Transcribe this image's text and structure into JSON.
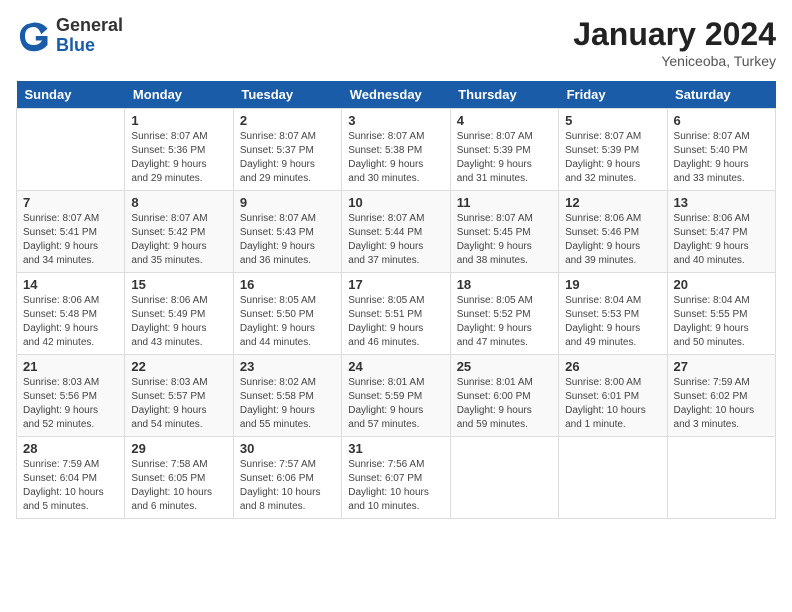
{
  "header": {
    "logo": {
      "general": "General",
      "blue": "Blue"
    },
    "title": "January 2024",
    "subtitle": "Yeniceoba, Turkey"
  },
  "days_of_week": [
    "Sunday",
    "Monday",
    "Tuesday",
    "Wednesday",
    "Thursday",
    "Friday",
    "Saturday"
  ],
  "weeks": [
    [
      {
        "day": "",
        "info": ""
      },
      {
        "day": "1",
        "info": "Sunrise: 8:07 AM\nSunset: 5:36 PM\nDaylight: 9 hours\nand 29 minutes."
      },
      {
        "day": "2",
        "info": "Sunrise: 8:07 AM\nSunset: 5:37 PM\nDaylight: 9 hours\nand 29 minutes."
      },
      {
        "day": "3",
        "info": "Sunrise: 8:07 AM\nSunset: 5:38 PM\nDaylight: 9 hours\nand 30 minutes."
      },
      {
        "day": "4",
        "info": "Sunrise: 8:07 AM\nSunset: 5:39 PM\nDaylight: 9 hours\nand 31 minutes."
      },
      {
        "day": "5",
        "info": "Sunrise: 8:07 AM\nSunset: 5:39 PM\nDaylight: 9 hours\nand 32 minutes."
      },
      {
        "day": "6",
        "info": "Sunrise: 8:07 AM\nSunset: 5:40 PM\nDaylight: 9 hours\nand 33 minutes."
      }
    ],
    [
      {
        "day": "7",
        "info": "Sunrise: 8:07 AM\nSunset: 5:41 PM\nDaylight: 9 hours\nand 34 minutes."
      },
      {
        "day": "8",
        "info": "Sunrise: 8:07 AM\nSunset: 5:42 PM\nDaylight: 9 hours\nand 35 minutes."
      },
      {
        "day": "9",
        "info": "Sunrise: 8:07 AM\nSunset: 5:43 PM\nDaylight: 9 hours\nand 36 minutes."
      },
      {
        "day": "10",
        "info": "Sunrise: 8:07 AM\nSunset: 5:44 PM\nDaylight: 9 hours\nand 37 minutes."
      },
      {
        "day": "11",
        "info": "Sunrise: 8:07 AM\nSunset: 5:45 PM\nDaylight: 9 hours\nand 38 minutes."
      },
      {
        "day": "12",
        "info": "Sunrise: 8:06 AM\nSunset: 5:46 PM\nDaylight: 9 hours\nand 39 minutes."
      },
      {
        "day": "13",
        "info": "Sunrise: 8:06 AM\nSunset: 5:47 PM\nDaylight: 9 hours\nand 40 minutes."
      }
    ],
    [
      {
        "day": "14",
        "info": "Sunrise: 8:06 AM\nSunset: 5:48 PM\nDaylight: 9 hours\nand 42 minutes."
      },
      {
        "day": "15",
        "info": "Sunrise: 8:06 AM\nSunset: 5:49 PM\nDaylight: 9 hours\nand 43 minutes."
      },
      {
        "day": "16",
        "info": "Sunrise: 8:05 AM\nSunset: 5:50 PM\nDaylight: 9 hours\nand 44 minutes."
      },
      {
        "day": "17",
        "info": "Sunrise: 8:05 AM\nSunset: 5:51 PM\nDaylight: 9 hours\nand 46 minutes."
      },
      {
        "day": "18",
        "info": "Sunrise: 8:05 AM\nSunset: 5:52 PM\nDaylight: 9 hours\nand 47 minutes."
      },
      {
        "day": "19",
        "info": "Sunrise: 8:04 AM\nSunset: 5:53 PM\nDaylight: 9 hours\nand 49 minutes."
      },
      {
        "day": "20",
        "info": "Sunrise: 8:04 AM\nSunset: 5:55 PM\nDaylight: 9 hours\nand 50 minutes."
      }
    ],
    [
      {
        "day": "21",
        "info": "Sunrise: 8:03 AM\nSunset: 5:56 PM\nDaylight: 9 hours\nand 52 minutes."
      },
      {
        "day": "22",
        "info": "Sunrise: 8:03 AM\nSunset: 5:57 PM\nDaylight: 9 hours\nand 54 minutes."
      },
      {
        "day": "23",
        "info": "Sunrise: 8:02 AM\nSunset: 5:58 PM\nDaylight: 9 hours\nand 55 minutes."
      },
      {
        "day": "24",
        "info": "Sunrise: 8:01 AM\nSunset: 5:59 PM\nDaylight: 9 hours\nand 57 minutes."
      },
      {
        "day": "25",
        "info": "Sunrise: 8:01 AM\nSunset: 6:00 PM\nDaylight: 9 hours\nand 59 minutes."
      },
      {
        "day": "26",
        "info": "Sunrise: 8:00 AM\nSunset: 6:01 PM\nDaylight: 10 hours\nand 1 minute."
      },
      {
        "day": "27",
        "info": "Sunrise: 7:59 AM\nSunset: 6:02 PM\nDaylight: 10 hours\nand 3 minutes."
      }
    ],
    [
      {
        "day": "28",
        "info": "Sunrise: 7:59 AM\nSunset: 6:04 PM\nDaylight: 10 hours\nand 5 minutes."
      },
      {
        "day": "29",
        "info": "Sunrise: 7:58 AM\nSunset: 6:05 PM\nDaylight: 10 hours\nand 6 minutes."
      },
      {
        "day": "30",
        "info": "Sunrise: 7:57 AM\nSunset: 6:06 PM\nDaylight: 10 hours\nand 8 minutes."
      },
      {
        "day": "31",
        "info": "Sunrise: 7:56 AM\nSunset: 6:07 PM\nDaylight: 10 hours\nand 10 minutes."
      },
      {
        "day": "",
        "info": ""
      },
      {
        "day": "",
        "info": ""
      },
      {
        "day": "",
        "info": ""
      }
    ]
  ]
}
